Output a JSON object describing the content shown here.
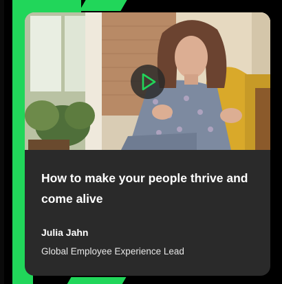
{
  "card": {
    "title": "How to make your people thrive and come alive",
    "speaker_name": "Julia Jahn",
    "speaker_role": "Global Employee Experience Lead",
    "play_icon": "play-icon",
    "accent_color": "#21d65a",
    "card_background": "#2a2a2a"
  }
}
